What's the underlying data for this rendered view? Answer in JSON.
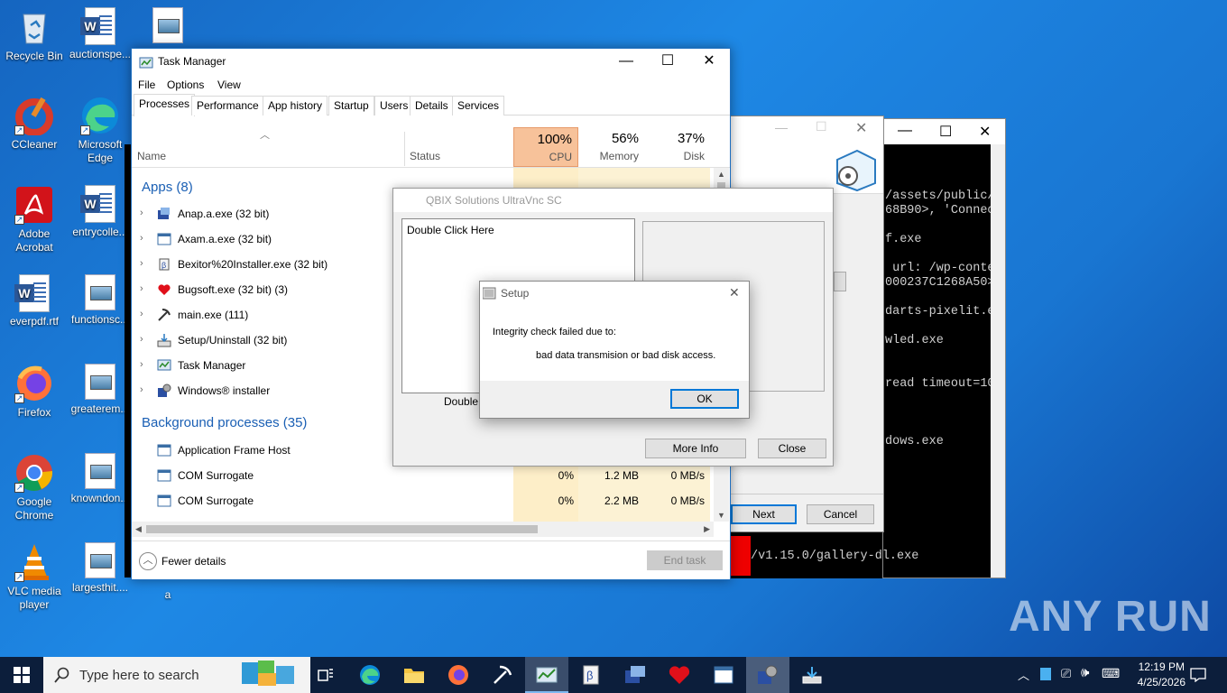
{
  "desktop_icons": [
    {
      "label": "Recycle Bin",
      "icon": "recycle-bin-icon"
    },
    {
      "label": "auctionspe...",
      "icon": "word-doc-icon"
    },
    {
      "label": "",
      "icon": "image-file-icon"
    },
    {
      "label": "CCleaner",
      "icon": "ccleaner-icon"
    },
    {
      "label": "Microsoft Edge",
      "icon": "edge-icon"
    },
    {
      "label": "Adobe Acrobat",
      "icon": "acrobat-icon"
    },
    {
      "label": "entrycolle...",
      "icon": "word-doc-icon"
    },
    {
      "label": "everpdf.rtf",
      "icon": "word-doc-icon"
    },
    {
      "label": "functionsc...",
      "icon": "image-file-icon"
    },
    {
      "label": "Firefox",
      "icon": "firefox-icon"
    },
    {
      "label": "greaterem...",
      "icon": "image-file-icon"
    },
    {
      "label": "Google Chrome",
      "icon": "chrome-icon"
    },
    {
      "label": "knowndon...",
      "icon": "image-file-icon"
    },
    {
      "label": "VLC media player",
      "icon": "vlc-icon"
    },
    {
      "label": "largesthit....",
      "icon": "image-file-icon"
    },
    {
      "label": "a",
      "icon": ""
    }
  ],
  "console": {
    "lines": [
      "/assets/public/",
      "68B90>, 'Connec",
      "",
      "f.exe",
      "",
      " url: /wp-conte",
      "000237C1268A50>",
      "",
      "darts-pixelit.e",
      "",
      "wled.exe",
      "",
      "",
      "read timeout=10",
      "",
      "",
      "",
      "dows.exe"
    ],
    "bottom_line": "/v1.15.0/gallery-dl.exe"
  },
  "wizard": {
    "next_label": "Next",
    "cancel_label": "Cancel"
  },
  "task_manager": {
    "title": "Task Manager",
    "menu": [
      "File",
      "Options",
      "View"
    ],
    "tabs": [
      "Processes",
      "Performance",
      "App history",
      "Startup",
      "Users",
      "Details",
      "Services"
    ],
    "columns": {
      "name": "Name",
      "status": "Status",
      "cpu": {
        "pct": "100%",
        "label": "CPU"
      },
      "memory": {
        "pct": "56%",
        "label": "Memory"
      },
      "disk": {
        "pct": "37%",
        "label": "Disk"
      }
    },
    "apps_header": "Apps (8)",
    "apps": [
      {
        "name": "Anap.a.exe (32 bit)"
      },
      {
        "name": "Axam.a.exe (32 bit)"
      },
      {
        "name": "Bexitor%20Installer.exe (32 bit)"
      },
      {
        "name": "Bugsoft.exe (32 bit) (3)"
      },
      {
        "name": "main.exe (111)"
      },
      {
        "name": "Setup/Uninstall (32 bit)"
      },
      {
        "name": "Task Manager"
      },
      {
        "name": "Windows® installer"
      }
    ],
    "bg_header": "Background processes (35)",
    "bg": [
      {
        "name": "Application Frame Host",
        "cpu": "",
        "mem": "",
        "disk": ""
      },
      {
        "name": "COM Surrogate",
        "cpu": "0%",
        "mem": "1.2 MB",
        "disk": "0 MB/s"
      },
      {
        "name": "COM Surrogate",
        "cpu": "0%",
        "mem": "2.2 MB",
        "disk": "0 MB/s"
      }
    ],
    "fewer_details": "Fewer details",
    "end_task": "End task"
  },
  "vnc": {
    "title": "QBIX Solutions UltraVnc SC",
    "list_text": "Double Click Here",
    "caption": "Double C",
    "more_info": "More Info",
    "close": "Close"
  },
  "setup_dialog": {
    "title": "Setup",
    "line1": "Integrity check failed due to:",
    "line2": "bad data transmision or bad disk access.",
    "ok": "OK"
  },
  "taskbar": {
    "search_placeholder": "Type here to search",
    "time": "12:19 PM",
    "date": "4/25/2026"
  },
  "watermark": "ANY RUN"
}
